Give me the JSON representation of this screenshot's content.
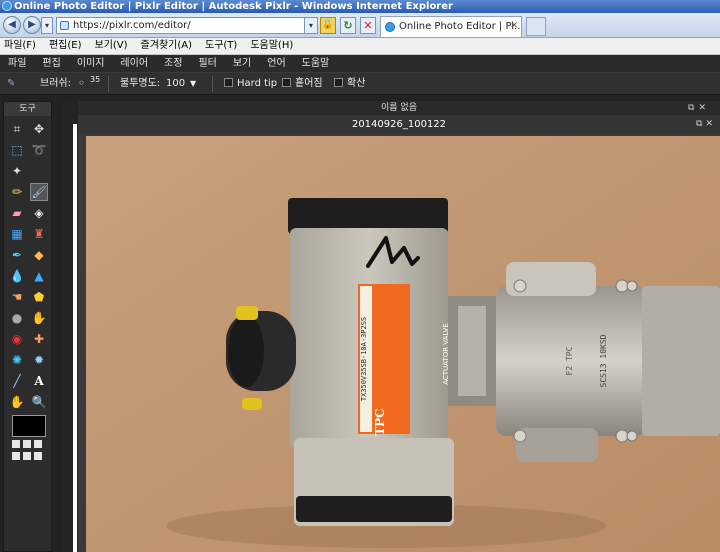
{
  "browser": {
    "window_title": "Online Photo Editor | Pixlr Editor | Autodesk Pixlr - Windows Internet Explorer",
    "url": "https://pixlr.com/editor/",
    "tab_title": "Online Photo Editor | Pi...",
    "menu": [
      "파일(F)",
      "편집(E)",
      "보기(V)",
      "즐겨찾기(A)",
      "도구(T)",
      "도움말(H)"
    ],
    "colors": {
      "titlebar": "#2a5bb2",
      "chrome": "#dfe9f5"
    }
  },
  "editor": {
    "menu": [
      "파일",
      "편집",
      "이미지",
      "레이어",
      "조정",
      "필터",
      "보기",
      "언어",
      "도움말"
    ],
    "options": {
      "brush_label": "브러쉬:",
      "brush_size": "35",
      "opacity_label": "불투명도:",
      "opacity_value": "100",
      "hard_tip_label": "Hard tip",
      "scatter_label": "흩어짐",
      "spread_label": "확산"
    },
    "toolbox_title": "도구",
    "tools": [
      "crop-icon",
      "move-icon",
      "marquee-icon",
      "lasso-icon",
      "wand-icon",
      "pencil-icon",
      "brush-icon",
      "eraser-icon",
      "bucket-icon",
      "gradient-icon",
      "clone-stamp-icon",
      "color-replace-icon",
      "drawing-icon",
      "blur-icon",
      "sharpen-icon",
      "smudge-icon",
      "sponge-icon",
      "dodge-icon",
      "burn-icon",
      "red-eye-icon",
      "spot-heal-icon",
      "bloat-icon",
      "pinch-icon",
      "color-picker-icon",
      "type-icon",
      "hand-icon",
      "zoom-icon"
    ],
    "selected_tool": "brush-icon",
    "document_title": "이름 없음",
    "image_title": "20140926_100122",
    "colors": {
      "panel": "#2b2b2b",
      "foreground_swatch": "#000000",
      "table": "#c49a76",
      "valve_body": "#b7b2a8",
      "label_orange": "#ef6a1e"
    }
  },
  "photo": {
    "label_brand": "TPC",
    "label_heading": "ACTUATOR VALVE",
    "label_model": "TX350V35SB-10A-3P2SS",
    "body_marking": "F2 TPC",
    "ball_marking": "SCS13 10KSD"
  }
}
